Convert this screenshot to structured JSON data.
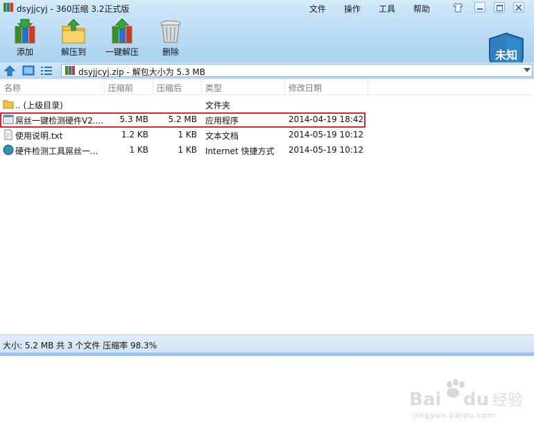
{
  "window": {
    "title": "dsyjjcyj - 360压缩 3.2正式版",
    "menu": [
      "文件",
      "操作",
      "工具",
      "帮助"
    ]
  },
  "toolbar": {
    "buttons": [
      {
        "label": "添加",
        "icon": "add-archive-icon"
      },
      {
        "label": "解压到",
        "icon": "extract-to-icon"
      },
      {
        "label": "一键解压",
        "icon": "one-click-extract-icon"
      },
      {
        "label": "删除",
        "icon": "trash-icon"
      }
    ],
    "security_badge": "未知"
  },
  "address": {
    "path": "dsyjjcyj.zip - 解包大小为 5.3 MB"
  },
  "columns": {
    "name": "名称",
    "compressed": "压缩前",
    "uncompressed": "压缩后",
    "type": "类型",
    "modified": "修改日期"
  },
  "files": [
    {
      "name": ".. (上级目录)",
      "before": "",
      "after": "",
      "type": "文件夹",
      "date": "",
      "icon": "folder-icon"
    },
    {
      "name": "屌丝一键检测硬件V2....",
      "before": "5.3 MB",
      "after": "5.2 MB",
      "type": "应用程序",
      "date": "2014-04-19 18:42",
      "icon": "exe-icon",
      "highlighted": true
    },
    {
      "name": "使用说明.txt",
      "before": "1.2 KB",
      "after": "1 KB",
      "type": "文本文档",
      "date": "2014-05-19 10:12",
      "icon": "text-file-icon"
    },
    {
      "name": "硬件检测工具屌丝一...",
      "before": "1 KB",
      "after": "1 KB",
      "type": "Internet 快捷方式",
      "date": "2014-05-19 10:12",
      "icon": "globe-icon"
    }
  ],
  "status": {
    "text": "大小: 5.2 MB 共 3 个文件 压缩率 98.3%"
  },
  "watermark": {
    "logo": "Bai du 经验",
    "url": "jingyan.baidu.com"
  },
  "colors": {
    "highlight_border": "#e0242b",
    "toolbar_bg": "#b9dbf3",
    "shield": "#2f7fc1"
  }
}
